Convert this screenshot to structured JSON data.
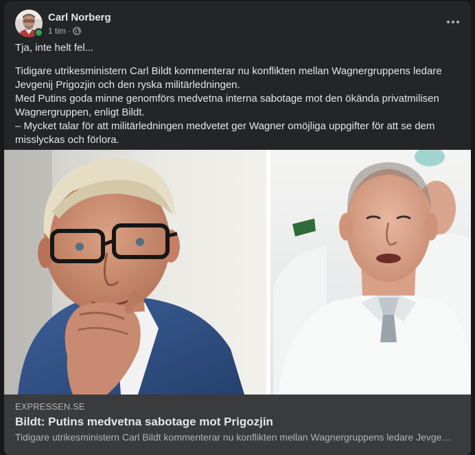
{
  "post": {
    "author": "Carl Norberg",
    "time": "1 tim",
    "separator": "·",
    "privacy_icon": "globe-icon",
    "more_icon": "more-options-icon",
    "intro": "Tja, inte helt fel...",
    "paragraphs": [
      "Tidigare utrikesministern Carl Bildt kommenterar nu konflikten mellan Wagnergruppens ledare Jevgenij Prigozjin och den ryska militärledningen.",
      "Med Putins goda minne genomförs medvetna interna sabotage mot den ökända privatmilisen Wagnergruppen, enligt Bildt.",
      "– Mycket talar för att militärledningen medvetet ger Wagner omöjliga uppgifter för att se dem misslyckas och förlora."
    ]
  },
  "link_preview": {
    "domain": "EXPRESSEN.SE",
    "title": "Bildt: Putins medvetna sabotage mot Prigozjin",
    "description": "Tidigare utrikesministern Carl Bildt kommenterar nu konflikten mellan Wagnergruppens ledare Jevgenij Prigozjin och den ryska militärledningen."
  },
  "colors": {
    "page_bg": "#18191a",
    "card_bg": "#242526",
    "link_card_bg": "#3a3b3c",
    "primary_text": "#e4e6eb",
    "secondary_text": "#b0b3b8",
    "online": "#31a24c"
  }
}
